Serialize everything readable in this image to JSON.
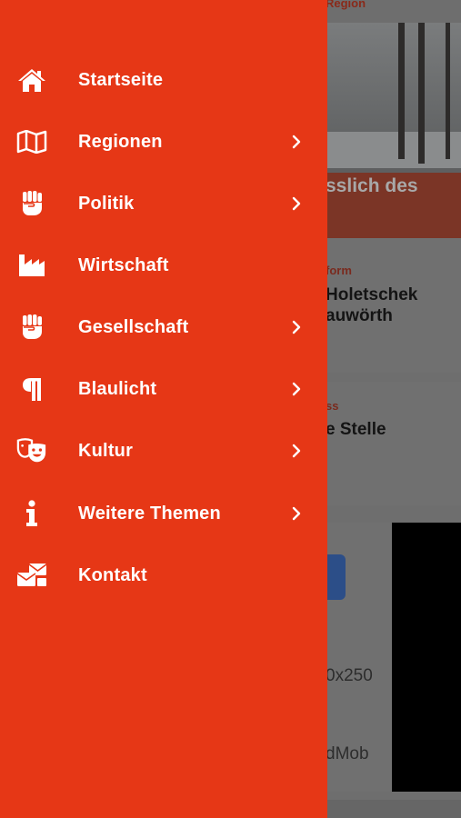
{
  "background": {
    "top_label": "Region",
    "hero_title": "sslich des",
    "cards": [
      {
        "kicker": "form",
        "headline_lines": [
          "Holetschek",
          "auwörth"
        ]
      },
      {
        "kicker": "ss",
        "headline_lines": [
          "e Stelle"
        ]
      }
    ],
    "ad": {
      "size_text": "0x250",
      "network_text": "dMob"
    }
  },
  "drawer": {
    "background_color": "#e63716",
    "text_color": "#ffffff",
    "items": [
      {
        "label": "Startseite",
        "icon": "home-icon",
        "has_submenu": false
      },
      {
        "label": "Regionen",
        "icon": "map-icon",
        "has_submenu": true
      },
      {
        "label": "Politik",
        "icon": "raised-fist-icon",
        "has_submenu": true
      },
      {
        "label": "Wirtschaft",
        "icon": "industry-icon",
        "has_submenu": false
      },
      {
        "label": "Gesellschaft",
        "icon": "raised-fist-icon",
        "has_submenu": true
      },
      {
        "label": "Blaulicht",
        "icon": "paragraph-icon",
        "has_submenu": true
      },
      {
        "label": "Kultur",
        "icon": "theater-masks-icon",
        "has_submenu": true
      },
      {
        "label": "Weitere Themen",
        "icon": "info-icon",
        "has_submenu": true
      },
      {
        "label": "Kontakt",
        "icon": "mail-bulk-icon",
        "has_submenu": false
      }
    ]
  }
}
